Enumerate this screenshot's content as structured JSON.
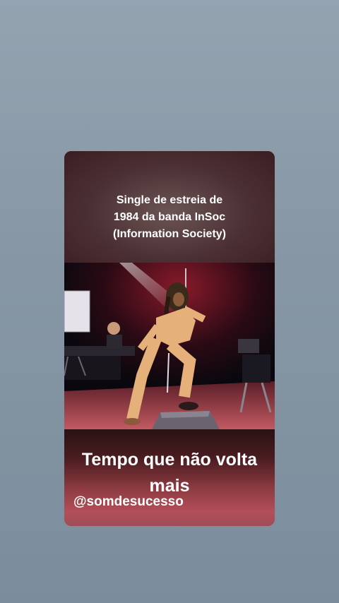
{
  "story": {
    "top_text": {
      "line1": "Single de estreia de",
      "line2": "1984 da banda InSoc",
      "line3": "(Information Society)"
    },
    "caption": {
      "line1": "Tempo que não volta",
      "line2": "mais"
    },
    "handle": "@somdesucesso"
  },
  "colors": {
    "page_background": "#8797a5",
    "text": "#ffffff",
    "bottom_accent": "#b44e58"
  }
}
